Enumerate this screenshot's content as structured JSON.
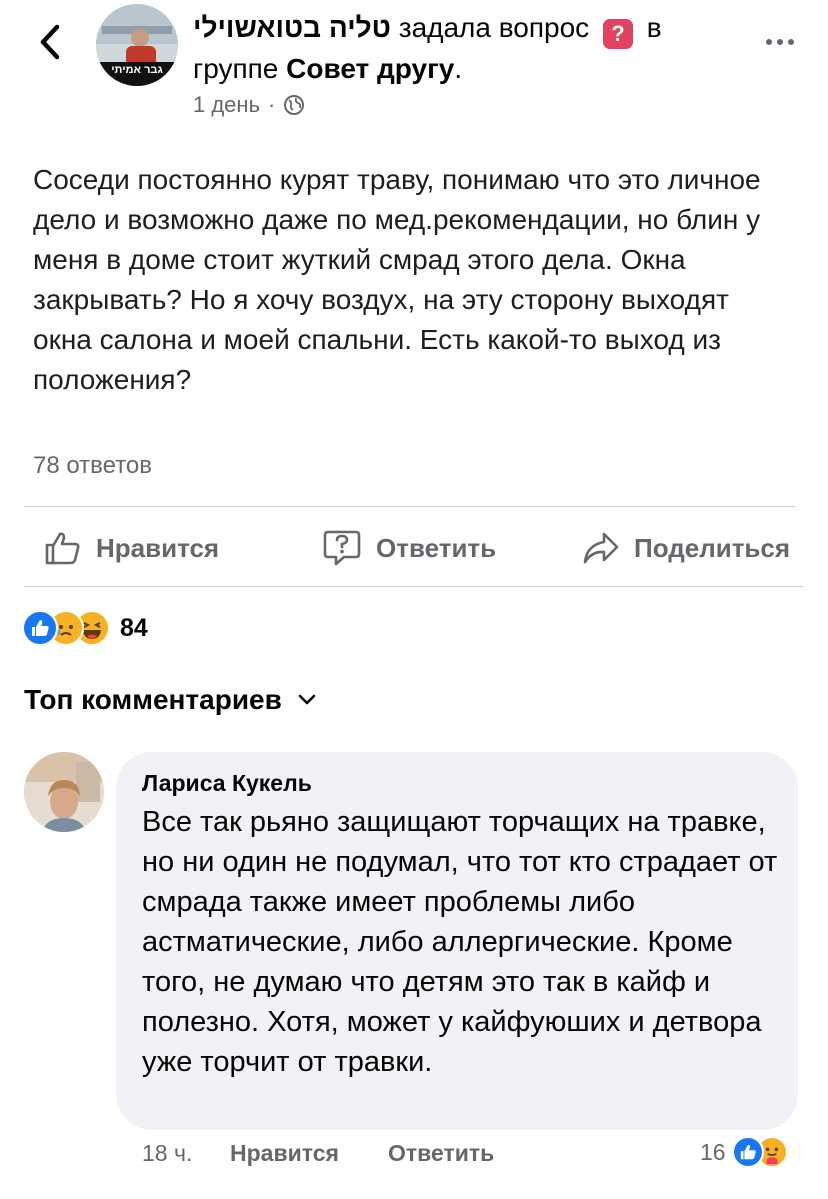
{
  "header": {
    "author": "טליה בטואשוילי",
    "action_text": "задала вопрос",
    "in_text": "в",
    "group_prefix": "группе",
    "group_name": "Совет другу",
    "group_suffix": ".",
    "time": "1 день",
    "separator": "·",
    "avatar_caption": "גבר אמיתי"
  },
  "post": {
    "body": "Соседи постоянно курят траву, понимаю что это личное дело и возможно даже по мед.рекомендации, но блин у меня в доме стоит жуткий смрад этого дела. Окна закрывать? Но я хочу воздух, на эту сторону выходят окна салона и моей спальни. Есть какой-то выход из положения?",
    "answers_count": "78 ответов"
  },
  "actions": {
    "like": "Нравится",
    "reply": "Ответить",
    "share": "Поделиться"
  },
  "reactions": {
    "count": "84"
  },
  "comments_section": {
    "sort_label": "Топ комментариев"
  },
  "comment": {
    "author": "Лариса Кукель",
    "text": "Все так рьяно защищают торчащих на травке, но ни один не подумал, что тот кто страдает от смрада также имеет проблемы либо астматические, либо аллергические. Кроме того, не думаю что детям это так в кайф и полезно. Хотя, может у кайфуюших и детвора уже торчит от травки.",
    "time": "18 ч.",
    "like": "Нравится",
    "reply": "Ответить",
    "reaction_count": "16"
  },
  "colors": {
    "accent_blue": "#1877f2",
    "question_badge": "#e4405f",
    "muted_text": "#65676b",
    "bubble_bg": "#f0f2f5"
  }
}
